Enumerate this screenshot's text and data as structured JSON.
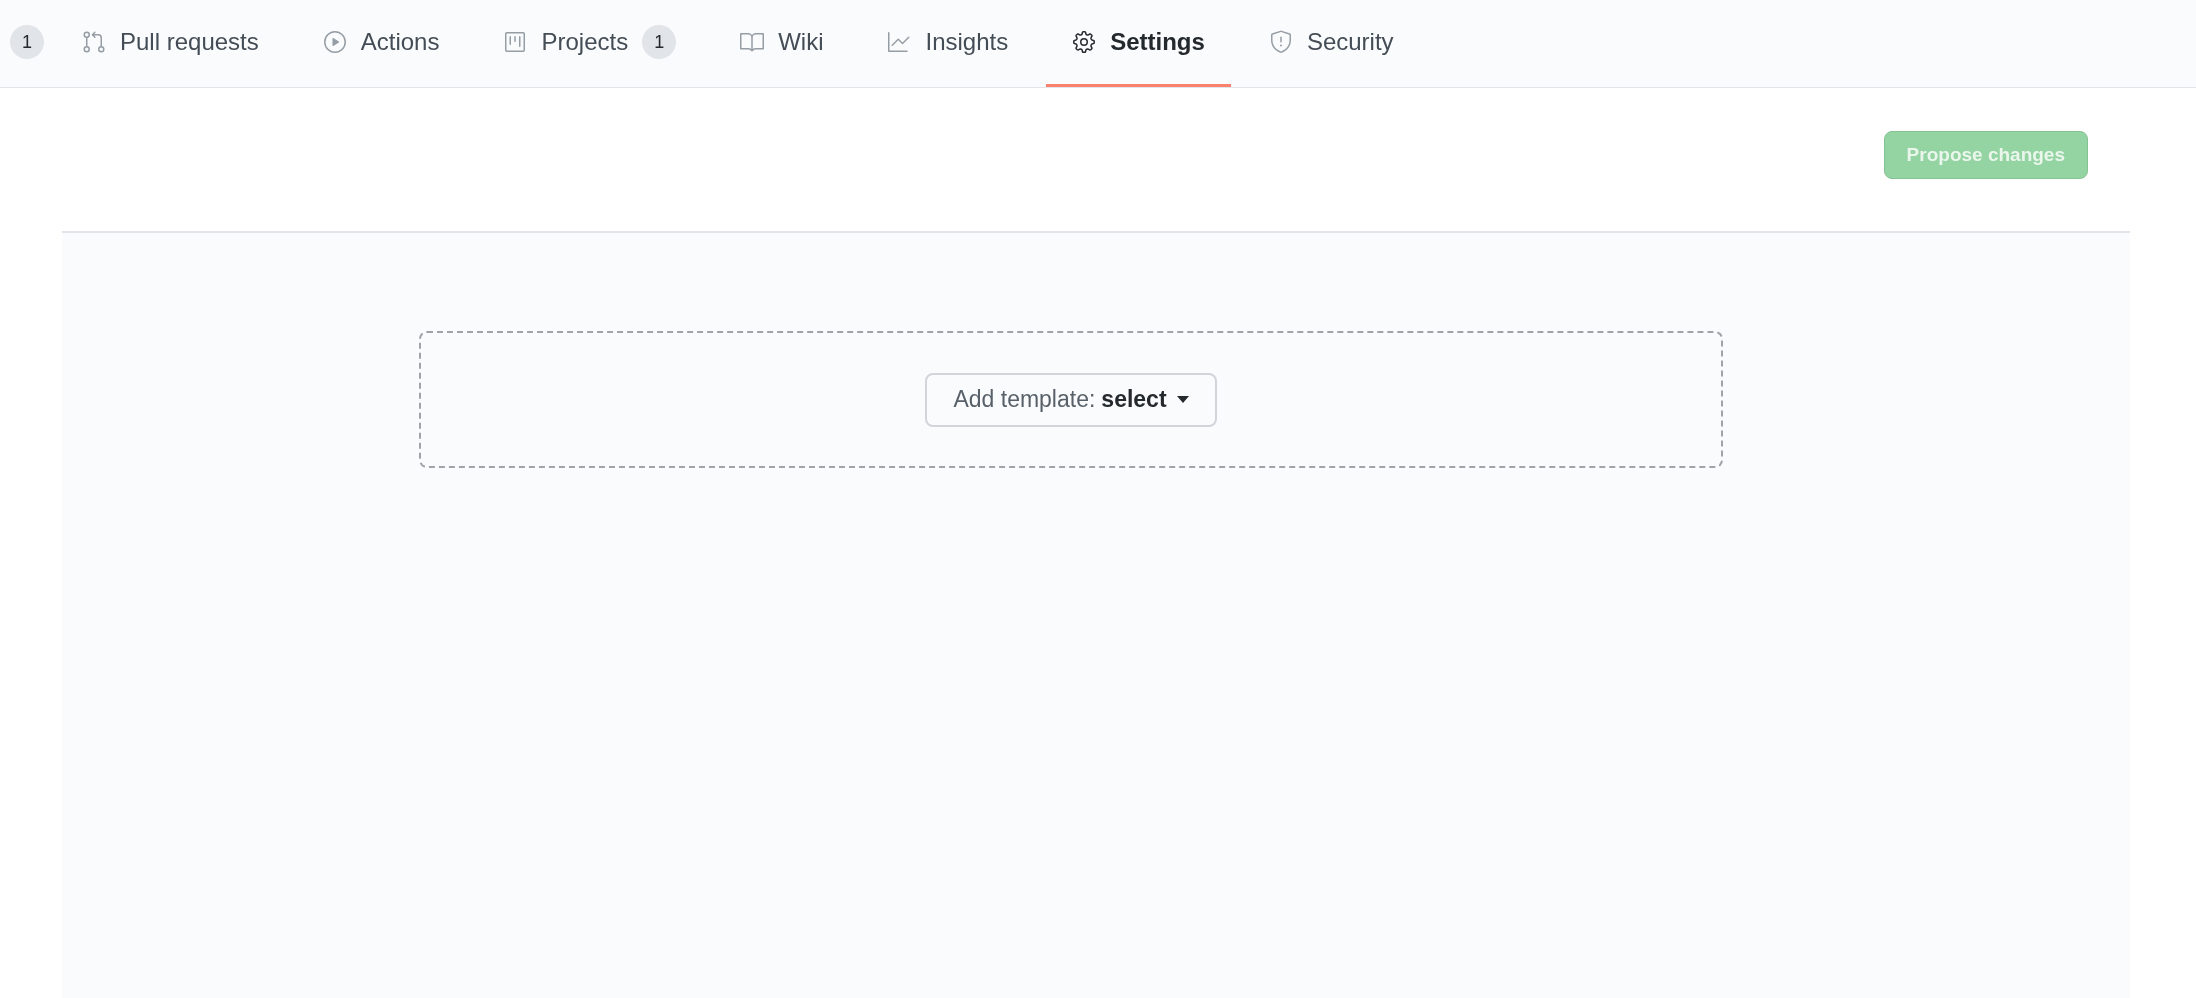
{
  "tabs": [
    {
      "kind": "plain",
      "counter": "1",
      "selected": false
    },
    {
      "kind": "pulls",
      "label": "Pull requests",
      "selected": false
    },
    {
      "kind": "actions",
      "label": "Actions",
      "selected": false
    },
    {
      "kind": "projects",
      "label": "Projects",
      "counter": "1",
      "selected": false
    },
    {
      "kind": "wiki",
      "label": "Wiki",
      "selected": false
    },
    {
      "kind": "insights",
      "label": "Insights",
      "selected": false
    },
    {
      "kind": "settings",
      "label": "Settings",
      "selected": true
    },
    {
      "kind": "security",
      "label": "Security",
      "selected": false
    }
  ],
  "propose_button": {
    "label": "Propose changes",
    "disabled": true
  },
  "template_select": {
    "label": "Add template:",
    "value": "select"
  }
}
